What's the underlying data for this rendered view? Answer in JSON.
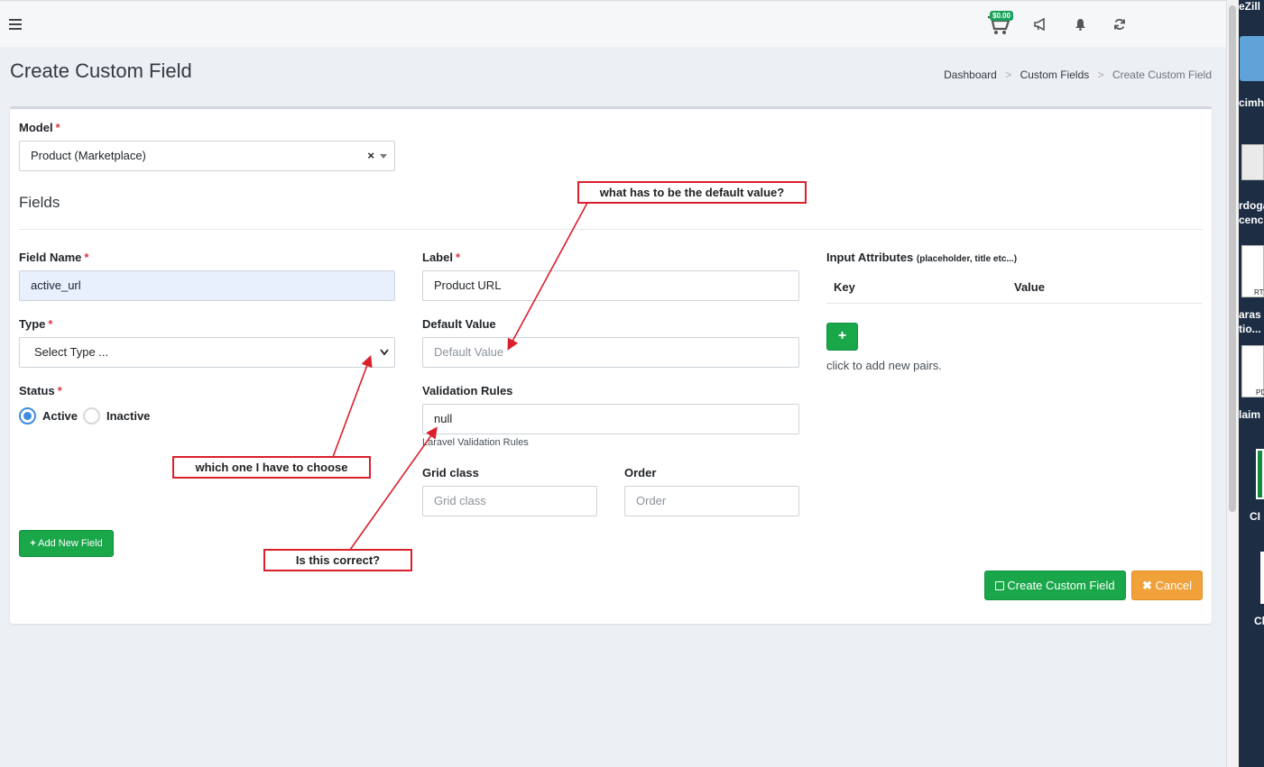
{
  "header": {
    "cart_amount": "$0.00",
    "icons": [
      "menu-icon",
      "cart-icon",
      "megaphone-icon",
      "bell-icon",
      "refresh-icon"
    ]
  },
  "page": {
    "title": "Create Custom Field",
    "breadcrumb": [
      "Dashboard",
      "Custom Fields",
      "Create Custom Field"
    ],
    "breadcrumb_sep": ">"
  },
  "form": {
    "model_label": "Model",
    "model_value": "Product (Marketplace)",
    "model_clear": "×",
    "fields_title": "Fields",
    "field_name_label": "Field Name",
    "field_name_value": "active_url",
    "type_label": "Type",
    "type_value": "Select Type ...",
    "status_label": "Status",
    "status_options": [
      "Active",
      "Inactive"
    ],
    "status_selected": "Active",
    "label_label": "Label",
    "label_value": "Product URL",
    "default_label": "Default Value",
    "default_placeholder": "Default Value",
    "validation_label": "Validation Rules",
    "validation_value": "null",
    "validation_help": "Laravel Validation Rules",
    "grid_label": "Grid class",
    "grid_placeholder": "Grid class",
    "order_label": "Order",
    "order_placeholder": "Order",
    "input_attr_label": "Input Attributes",
    "input_attr_note": "(placeholder, title etc...)",
    "key_header": "Key",
    "value_header": "Value",
    "add_pair_symbol": "+",
    "add_pair_hint": "click to add new pairs.",
    "add_field_button": "Add New Field",
    "create_button": "Create Custom Field",
    "cancel_button": "Cancel",
    "required_mark": "*"
  },
  "annotations": {
    "default_question": "what has to be the default value?",
    "type_question": "which one I have to choose",
    "validation_question": "Is this correct?"
  },
  "desktop_edge": {
    "labels": [
      "eZill",
      "cimh",
      "rdoga",
      "cenc",
      "RT",
      "aras",
      "tio...",
      "PD",
      "laim",
      "CI",
      "Cl"
    ]
  },
  "colors": {
    "primary_green": "#19a74a",
    "cancel_orange": "#f0a13a",
    "required_red": "#dc3545",
    "annotation_red": "#d9202c",
    "radio_blue": "#3e8de0"
  }
}
